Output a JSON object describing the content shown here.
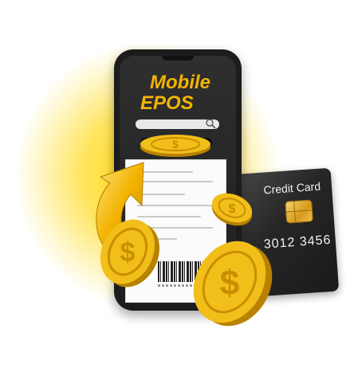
{
  "app": {
    "title_line1": "Mobile",
    "title_line2": "EPOS"
  },
  "card": {
    "label": "Credit Card",
    "number": "3012  3456"
  },
  "icons": {
    "search": "search-icon",
    "coin": "dollar-coin-icon",
    "arrow": "curved-arrow-icon",
    "barcode": "barcode-icon",
    "chip": "card-chip-icon"
  },
  "colors": {
    "gold": "#f4b400",
    "glow": "#ffd600",
    "phone_body": "#1c1c1c",
    "card_body": "#262626"
  }
}
